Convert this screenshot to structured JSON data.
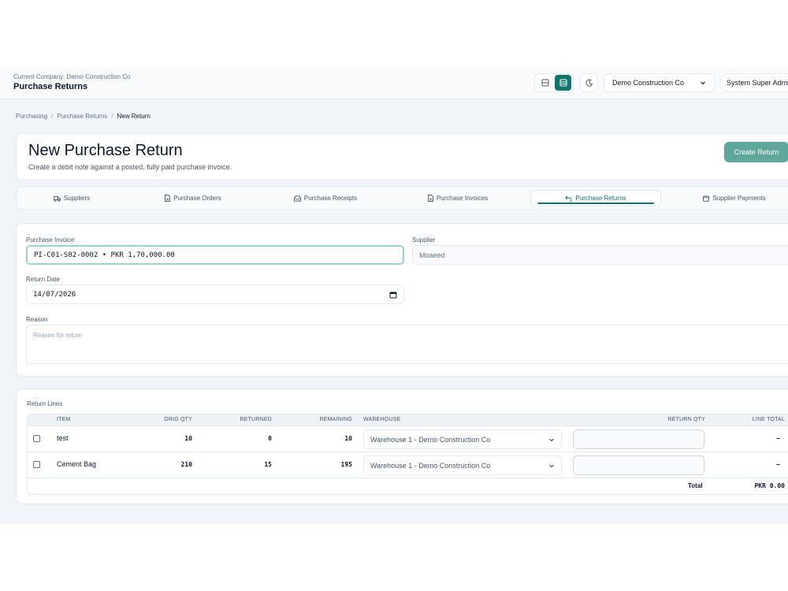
{
  "header": {
    "company_line": "Current Company: Demo Construction Co",
    "page_title": "Purchase Returns",
    "company_select": "Demo Construction Co",
    "user": "System Super Admin"
  },
  "breadcrumb": [
    "Purchasing",
    "Purchase Returns",
    "New Return"
  ],
  "hero": {
    "title": "New Purchase Return",
    "subtitle": "Create a debit note against a posted, fully paid purchase invoice.",
    "create_button": "Create Return"
  },
  "tabs": [
    {
      "label": "Suppliers",
      "icon": "truck-icon"
    },
    {
      "label": "Purchase Orders",
      "icon": "document-icon"
    },
    {
      "label": "Purchase Receipts",
      "icon": "inbox-icon"
    },
    {
      "label": "Purchase Invoices",
      "icon": "document-icon"
    },
    {
      "label": "Purchase Returns",
      "icon": "undo-icon",
      "active": true
    },
    {
      "label": "Supplier Payments",
      "icon": "wallet-icon"
    }
  ],
  "form": {
    "invoice_label": "Purchase Invoice",
    "invoice_value": "PI-C01-S02-0002 • PKR 1,70,000.00",
    "supplier_label": "Supplier",
    "supplier_value": "Moaeed",
    "date_label": "Return Date",
    "date_value": "14/07/2026",
    "reason_label": "Reason",
    "reason_placeholder": "Reason for return"
  },
  "lines": {
    "title": "Return Lines",
    "columns": [
      "Item",
      "Orig Qty",
      "Returned",
      "Remaining",
      "Warehouse",
      "Return Qty",
      "Line Total"
    ],
    "rows": [
      {
        "item": "test",
        "orig_qty": "10",
        "returned": "0",
        "remaining": "10",
        "warehouse": "Warehouse 1 - Demo Construction Co",
        "line_total": "–"
      },
      {
        "item": "Cement Bag",
        "orig_qty": "210",
        "returned": "15",
        "remaining": "195",
        "warehouse": "Warehouse 1 - Demo Construction Co",
        "line_total": "–"
      }
    ],
    "total_label": "Total",
    "total_value": "PKR 0.00"
  },
  "colors": {
    "accent": "#0f766e",
    "button": "#5fa69b",
    "focus": "#99d5cb"
  }
}
